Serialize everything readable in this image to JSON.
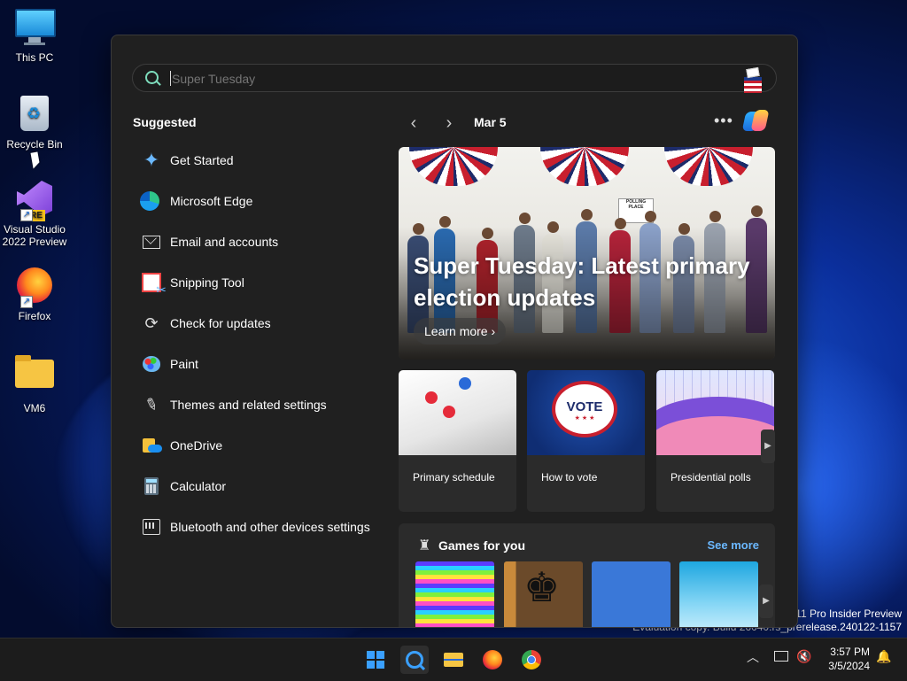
{
  "desktop": {
    "icons": [
      {
        "label": "This PC"
      },
      {
        "label": "Recycle Bin"
      },
      {
        "label": "Visual Studio 2022 Preview",
        "badge": "PRE"
      },
      {
        "label": "Firefox"
      },
      {
        "label": "VM6"
      }
    ],
    "watermark": {
      "line1": "s 11 Pro Insider Preview",
      "line2": "Evaluation copy. Build 26040.rs_prerelease.240122-1157"
    }
  },
  "search": {
    "query": "Super Tuesday",
    "suggested_title": "Suggested",
    "suggested": [
      {
        "label": "Get Started",
        "icon": "get-started-icon"
      },
      {
        "label": "Microsoft Edge",
        "icon": "edge-icon"
      },
      {
        "label": "Email and accounts",
        "icon": "mail-icon"
      },
      {
        "label": "Snipping Tool",
        "icon": "snipping-tool-icon"
      },
      {
        "label": "Check for updates",
        "icon": "refresh-icon"
      },
      {
        "label": "Paint",
        "icon": "paint-icon"
      },
      {
        "label": "Themes and related settings",
        "icon": "brush-icon"
      },
      {
        "label": "OneDrive",
        "icon": "onedrive-icon"
      },
      {
        "label": "Calculator",
        "icon": "calculator-icon"
      },
      {
        "label": "Bluetooth and other devices settings",
        "icon": "bluetooth-devices-icon"
      }
    ],
    "highlights": {
      "date": "Mar 5",
      "hero": {
        "title": "Super Tuesday: Latest primary election updates",
        "button": "Learn more",
        "poll_sign": "POLLING PLACE"
      },
      "cards": [
        {
          "caption": "Primary schedule"
        },
        {
          "caption": "How to vote",
          "badge_text": "VOTE"
        },
        {
          "caption": "Presidential polls"
        }
      ],
      "games": {
        "title": "Games for you",
        "see_more": "See more",
        "tiles": [
          "color-stripes-game",
          "chess-game",
          "blue-game",
          "sky-game"
        ]
      }
    }
  },
  "taskbar": {
    "time": "3:57 PM",
    "date": "3/5/2024"
  },
  "colors": {
    "accent": "#3aa0ff",
    "link": "#6bb8ff",
    "panel_bg": "#202020",
    "card_bg": "#2b2b2b"
  }
}
